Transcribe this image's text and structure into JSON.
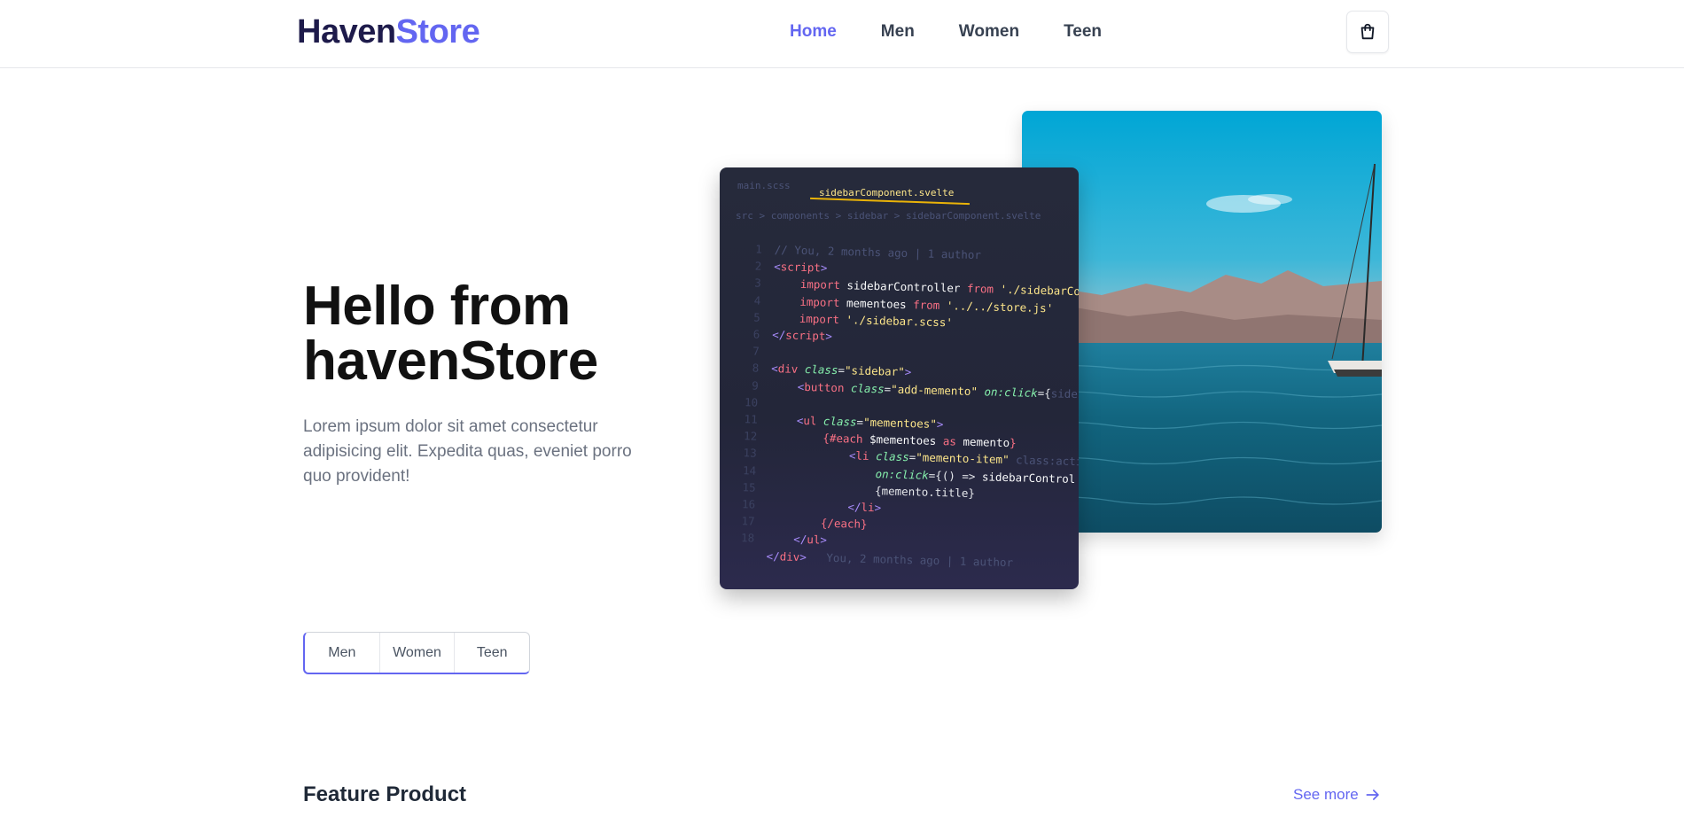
{
  "header": {
    "logo_part1": "Haven",
    "logo_part2": "Store",
    "nav": [
      {
        "label": "Home",
        "active": true
      },
      {
        "label": "Men",
        "active": false
      },
      {
        "label": "Women",
        "active": false
      },
      {
        "label": "Teen",
        "active": false
      }
    ],
    "cart_icon": "shopping-bag-icon"
  },
  "hero": {
    "title_line1": "Hello from",
    "title_line2": "havenStore",
    "description": "Lorem ipsum dolor sit amet consectetur adipisicing elit. Expedita quas, eveniet porro quo provident!"
  },
  "code_image": {
    "tab_active": "sidebarComponent.svelte",
    "tab_prev": "main.scss",
    "breadcrumb": "src > components > sidebar > sidebarComponent.svelte",
    "lines": [
      "1",
      "2",
      "3",
      "4",
      "5",
      "6",
      "7",
      "8",
      "9",
      "10",
      "11",
      "12",
      "13",
      "14",
      "15",
      "16",
      "17",
      "18"
    ]
  },
  "category_tabs": [
    "Men",
    "Women",
    "Teen"
  ],
  "feature": {
    "title": "Feature Product",
    "see_more": "See more"
  },
  "colors": {
    "accent": "#6366f1",
    "logo_dark": "#1e1b4b",
    "text_muted": "#6b7280"
  }
}
